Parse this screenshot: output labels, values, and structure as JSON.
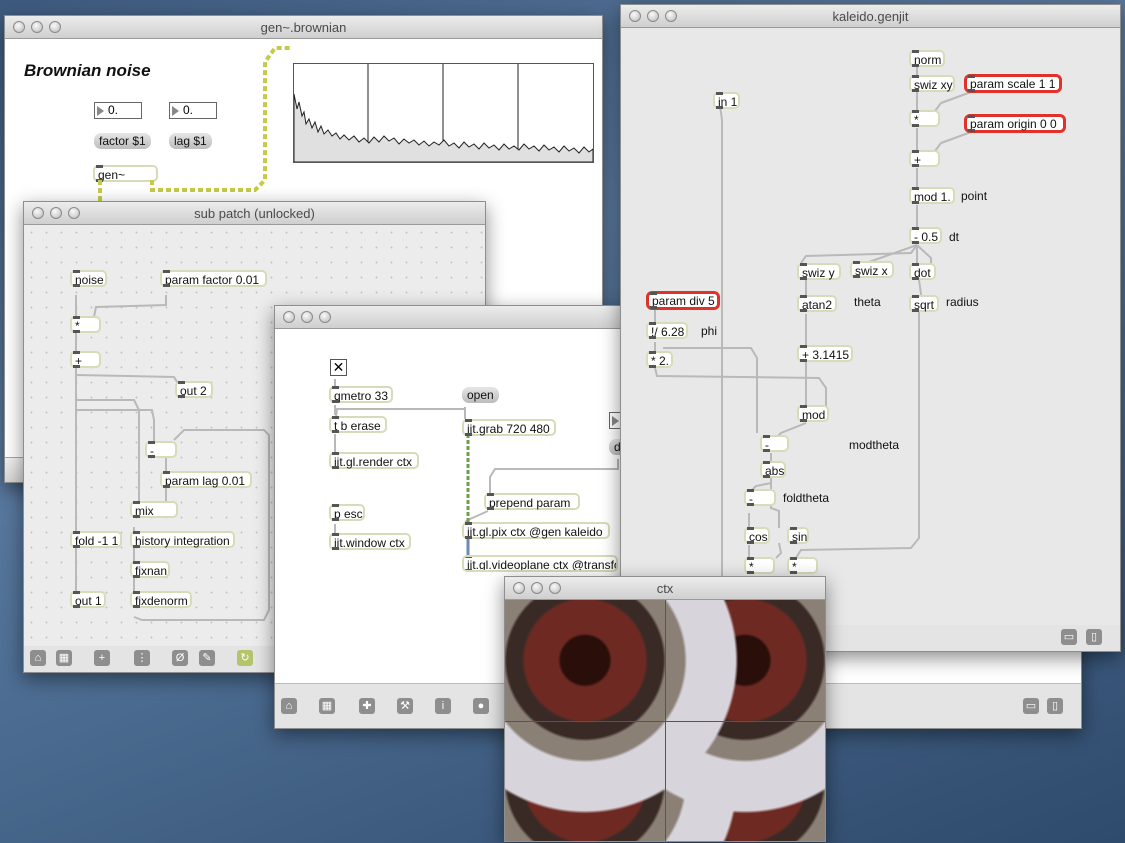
{
  "windows": {
    "brownian": {
      "title": "gen~.brownian",
      "heading": "Brownian noise",
      "numbox_factor": "0.",
      "numbox_lag": "0.",
      "msg_factor": "factor $1",
      "msg_lag": "lag $1",
      "gen_object": "gen~"
    },
    "subpatch": {
      "title": "sub patch (unlocked)",
      "objects": {
        "noise": "noise",
        "param_factor": "param factor 0.01",
        "mult": "*",
        "plus": "+",
        "out2": "out 2",
        "minus": "-",
        "param_lag": "param lag 0.01",
        "mix": "mix",
        "fold": "fold -1 1",
        "history": "history integration",
        "fixnan": "fixnan",
        "out1": "out 1",
        "fixdenorm": "fixdenorm"
      }
    },
    "main": {
      "objects": {
        "qmetro": "qmetro 33",
        "t_erase": "t b erase",
        "render": "jit.gl.render ctx",
        "open_msg": "open",
        "grab": "jit.grab 720 480",
        "prepend": "prepend param",
        "pix": "jit.gl.pix ctx @gen kaleido",
        "videoplane": "jit.gl.videoplane ctx @transfo",
        "p_esc": "p esc",
        "window": "jit.window ctx",
        "partial_msg": "d"
      }
    },
    "kaleido": {
      "title": "kaleido.genjit",
      "objects": {
        "norm": "norm",
        "swiz_xy": "swiz xy",
        "param_scale": "param scale 1 1",
        "mult1": "*",
        "param_origin": "param origin 0 0",
        "plus1": "+",
        "mod1": "mod 1.",
        "sub05": "- 0.5",
        "in1": "in 1",
        "swiz_y": "swiz y",
        "swiz_x": "swiz x",
        "dot": "dot",
        "atan2": "atan2",
        "sqrt": "sqrt",
        "param_div": "param div 5",
        "div628": "!/ 6.28",
        "mult2": "* 2.",
        "add31415": "+ 3.1415",
        "mod": "mod",
        "minus": "-",
        "abs": "abs",
        "minus2": "-",
        "cos": "cos",
        "sin": "sin",
        "multa": "*",
        "multb": "*"
      },
      "comments": {
        "point": "point",
        "dt": "dt",
        "theta": "theta",
        "radius": "radius",
        "phi": "phi",
        "modtheta": "modtheta",
        "foldtheta": "foldtheta"
      }
    },
    "ctx": {
      "title": "ctx"
    }
  }
}
